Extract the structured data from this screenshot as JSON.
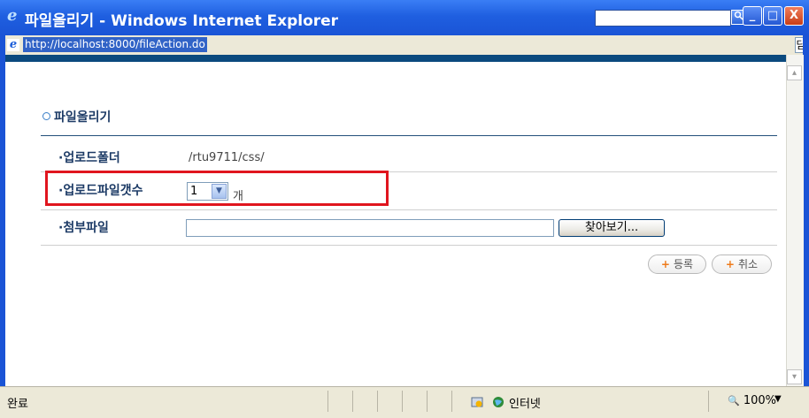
{
  "window": {
    "title": "파일올리기 - Windows Internet Explorer",
    "minimize_glyph": "_",
    "maximize_glyph": "□",
    "close_glyph": "X"
  },
  "address": {
    "url": "http://localhost:8000/fileAction.do",
    "right_fragment": "닫"
  },
  "page": {
    "section_title": "파일올리기",
    "rows": {
      "upload_folder_label": "·업로드폴더",
      "upload_folder_value": "/rtu9711/css/",
      "file_count_label": "·업로드파일갯수",
      "file_count_value": "1",
      "file_count_unit": "개",
      "attach_label": "·첨부파일"
    },
    "browse_label": "찾아보기...",
    "register_label": "등록",
    "cancel_label": "취소",
    "plus_glyph": "+"
  },
  "statusbar": {
    "status": "완료",
    "zone": "인터넷",
    "zoom": "100%",
    "zoom_glyph": "🔍"
  },
  "colors": {
    "title_blue": "#1f5fe0",
    "stripe": "#0b4a7e",
    "label": "#1d3b66",
    "highlight": "#e0151e",
    "accent_orange": "#ee7a1a"
  },
  "icons": {
    "ie_logo": "ie-logo",
    "search": "search-icon",
    "select_arrow": "chevron-down-icon",
    "plus": "plus-icon",
    "globe": "globe-icon"
  }
}
